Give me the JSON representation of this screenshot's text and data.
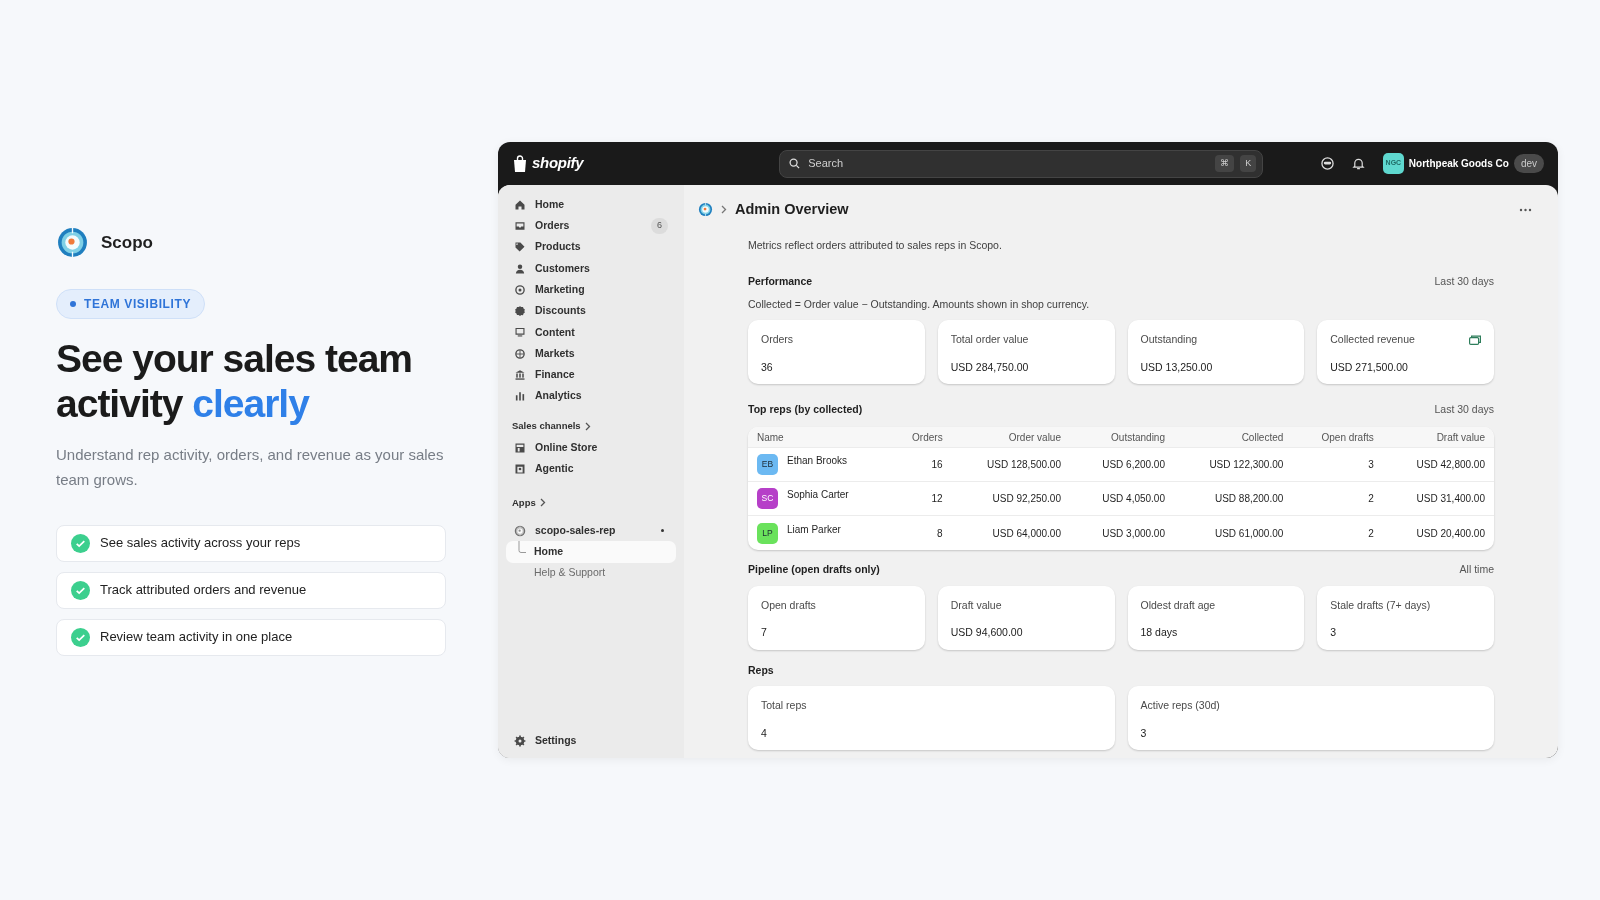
{
  "brand": {
    "name": "Scopo"
  },
  "badge": {
    "label": "TEAM VISIBILITY"
  },
  "headline": {
    "lead": "See your sales team activity",
    "highlight": "clearly"
  },
  "subtitle": "Understand rep activity, orders, and revenue as your sales team grows.",
  "features": [
    {
      "label": "See sales activity across your reps",
      "checked": true
    },
    {
      "label": "Track attributed orders and revenue",
      "checked": true
    },
    {
      "label": "Review team activity in one place",
      "checked": true
    }
  ],
  "app": {
    "topbar": {
      "logo_text": "shopify",
      "search": {
        "placeholder": "Search"
      },
      "shortcut_keys": [
        "⌘",
        "K"
      ],
      "store": {
        "initials": "NGC",
        "name": "Northpeak Goods Co",
        "badge": "dev"
      }
    },
    "sidebar": {
      "items": [
        {
          "label": "Home",
          "selected": false
        },
        {
          "label": "Orders",
          "count": "6",
          "selected": false
        },
        {
          "label": "Products",
          "selected": false
        },
        {
          "label": "Customers",
          "selected": false
        },
        {
          "label": "Marketing",
          "selected": false
        },
        {
          "label": "Discounts",
          "selected": false
        },
        {
          "label": "Content",
          "selected": false
        },
        {
          "label": "Markets",
          "selected": false
        },
        {
          "label": "Finance",
          "selected": false
        },
        {
          "label": "Analytics",
          "selected": false
        }
      ],
      "sales_channels": {
        "title": "Sales channels",
        "items": [
          {
            "label": "Online Store",
            "selected": false
          },
          {
            "label": "Agentic",
            "selected": false
          }
        ]
      },
      "apps": {
        "title": "Apps",
        "app": {
          "name": "scopo-sales-rep",
          "pages": [
            {
              "label": "Home",
              "selected": true
            },
            {
              "label": "Help & Support",
              "selected": false
            }
          ]
        }
      },
      "settings": {
        "label": "Settings"
      }
    },
    "page": {
      "title": "Admin Overview",
      "intro": "Metrics reflect orders attributed to sales reps in Scopo.",
      "performance": {
        "title": "Performance",
        "period": "Last 30 days",
        "note": "Collected = Order value − Outstanding. Amounts shown in shop currency.",
        "metrics": [
          {
            "label": "Orders",
            "value": "36"
          },
          {
            "label": "Total order value",
            "value": "USD 284,750.00"
          },
          {
            "label": "Outstanding",
            "value": "USD 13,250.00"
          },
          {
            "label": "Collected revenue",
            "value": "USD 271,500.00"
          }
        ]
      },
      "top_reps": {
        "title": "Top reps (by collected)",
        "period": "Last 30 days",
        "columns": [
          "Name",
          "Orders",
          "Order value",
          "Outstanding",
          "Collected",
          "Open drafts",
          "Draft value"
        ],
        "rows": [
          {
            "initials": "EB",
            "color": "#6cb9f2",
            "cells": [
              "Ethan Brooks",
              "16",
              "USD 128,500.00",
              "USD 6,200.00",
              "USD 122,300.00",
              "3",
              "USD 42,800.00"
            ]
          },
          {
            "initials": "SC",
            "color": "#b63fc8",
            "cells": [
              "Sophia Carter",
              "12",
              "USD 92,250.00",
              "USD 4,050.00",
              "USD 88,200.00",
              "2",
              "USD 31,400.00"
            ]
          },
          {
            "initials": "LP",
            "color": "#6ae25c",
            "cells": [
              "Liam Parker",
              "8",
              "USD 64,000.00",
              "USD 3,000.00",
              "USD 61,000.00",
              "2",
              "USD 20,400.00"
            ]
          }
        ]
      },
      "pipeline": {
        "title": "Pipeline (open drafts only)",
        "period": "All time",
        "metrics": [
          {
            "label": "Open drafts",
            "value": "7"
          },
          {
            "label": "Draft value",
            "value": "USD 94,600.00"
          },
          {
            "label": "Oldest draft age",
            "value": "18 days"
          },
          {
            "label": "Stale drafts (7+ days)",
            "value": "3"
          }
        ]
      },
      "reps": {
        "title": "Reps",
        "metrics": [
          {
            "label": "Total reps",
            "value": "4"
          },
          {
            "label": "Active reps (30d)",
            "value": "3"
          }
        ]
      }
    }
  }
}
